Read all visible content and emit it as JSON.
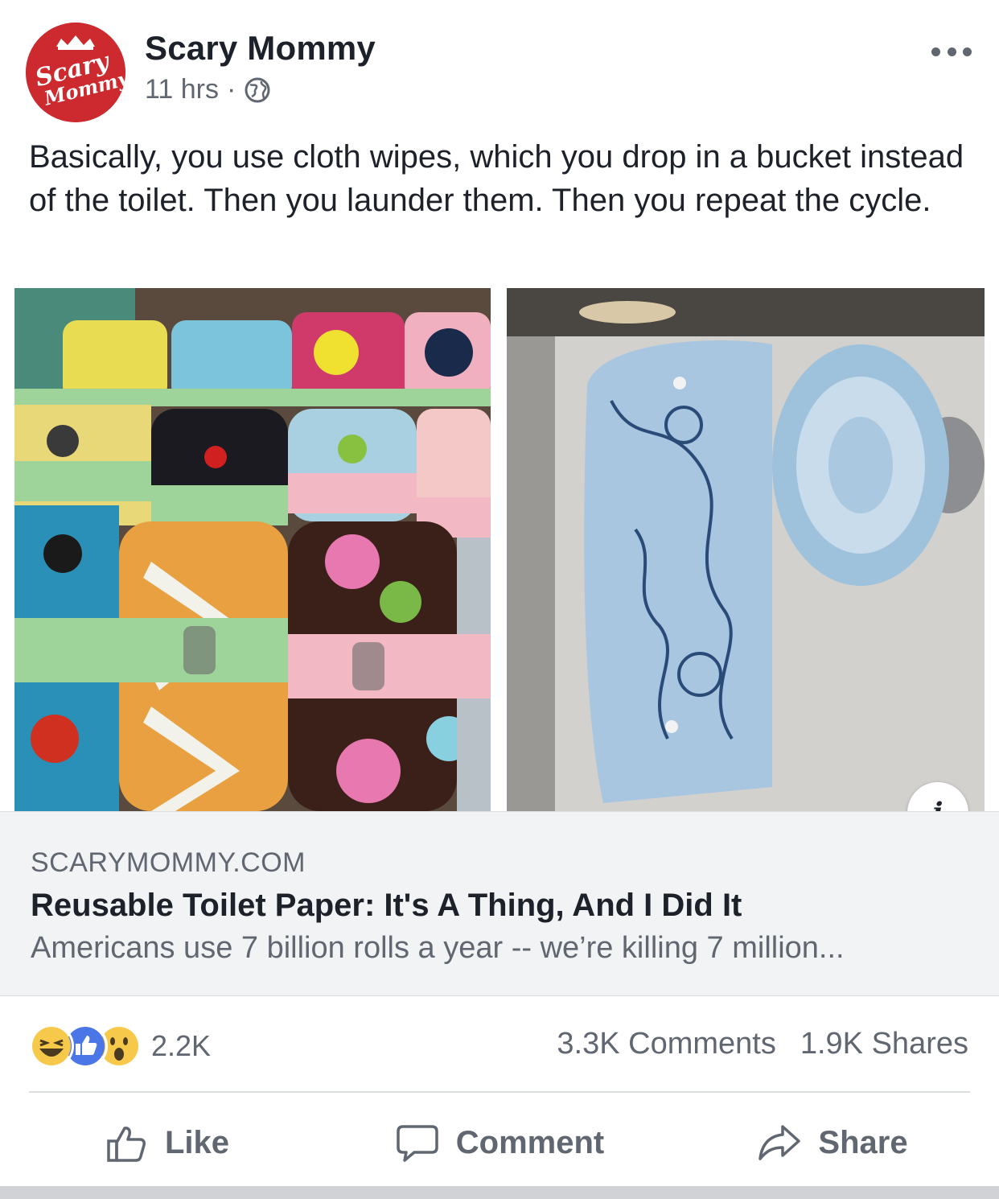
{
  "post": {
    "page_name": "Scary Mommy",
    "timestamp": "11 hrs",
    "separator": "·",
    "avatar_text_line1": "Scary",
    "avatar_text_line2": "Mommy",
    "text": "Basically, you use cloth wipes, which you drop in a bucket instead of the toilet. Then you launder them. Then you repeat the cycle."
  },
  "icons": {
    "more": "more-icon",
    "globe": "globe-icon",
    "info": "info-icon",
    "info_glyph": "i",
    "like": "like-icon",
    "comment": "comment-icon",
    "share": "share-icon"
  },
  "link": {
    "domain": "SCARYMOMMY.COM",
    "title": "Reusable Toilet Paper: It's A Thing, And I Did It",
    "description": "Americans use 7 billion rolls a year -- we’re killing 7 million..."
  },
  "stats": {
    "reaction_count": "2.2K",
    "comments": "3.3K Comments",
    "shares": "1.9K Shares",
    "reactions": [
      "haha",
      "like",
      "wow"
    ]
  },
  "actions": {
    "like": "Like",
    "comment": "Comment",
    "share": "Share"
  },
  "colors": {
    "brand_red": "#cc2a2e",
    "text": "#1d2129",
    "secondary": "#606770",
    "link_bg": "#f2f3f5",
    "like_blue": "#4a76e8",
    "reaction_yellow": "#f7c94b"
  }
}
